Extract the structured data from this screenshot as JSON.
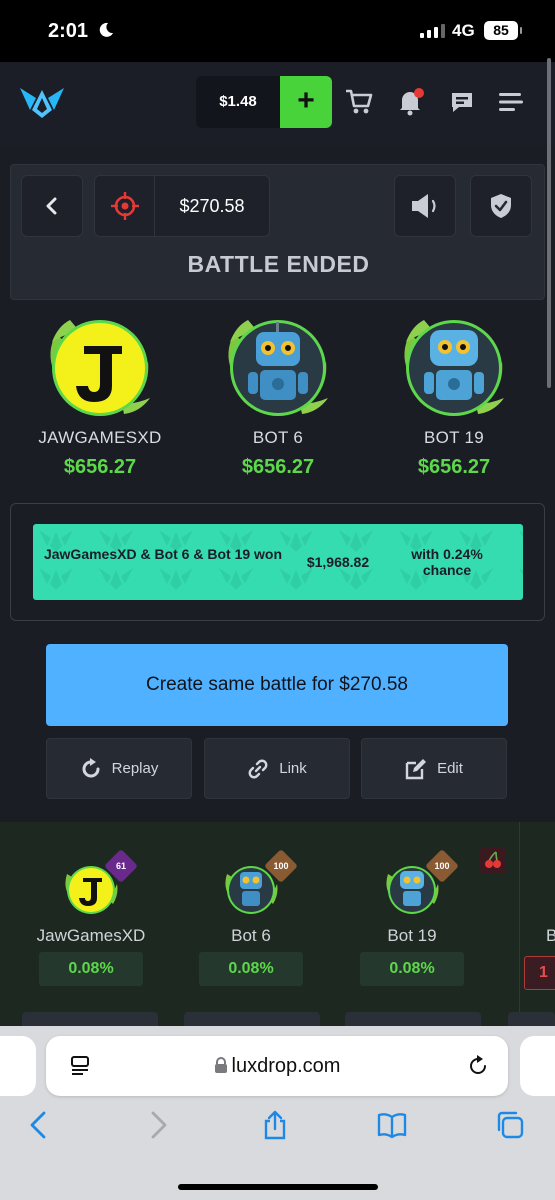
{
  "status_bar": {
    "time": "2:01",
    "network": "4G",
    "battery": "85"
  },
  "header": {
    "balance": "$1.48",
    "deposit_label": "+"
  },
  "battle": {
    "price": "$270.58",
    "title": "BATTLE ENDED"
  },
  "players": [
    {
      "name": "JAWGAMESXD",
      "amount": "$656.27"
    },
    {
      "name": "BOT 6",
      "amount": "$656.27"
    },
    {
      "name": "BOT 19",
      "amount": "$656.27"
    }
  ],
  "result": {
    "winners": "JawGamesXD & Bot 6 & Bot 19 won",
    "total": "$1,968.82",
    "chance": "with 0.24% chance"
  },
  "actions": {
    "create": "Create same battle for $270.58",
    "replay": "Replay",
    "link": "Link",
    "edit": "Edit"
  },
  "participants": [
    {
      "name": "JawGamesXD",
      "level": "61",
      "chance": "0.08%",
      "level_color": "#6a2a8c"
    },
    {
      "name": "Bot 6",
      "level": "100",
      "chance": "0.08%",
      "level_color": "#8a5a32"
    },
    {
      "name": "Bot 19",
      "level": "100",
      "chance": "0.08%",
      "level_color": "#8a5a32"
    }
  ],
  "peek": {
    "name": "B",
    "chance": "1"
  },
  "browser": {
    "url": "luxdrop.com"
  },
  "colors": {
    "accent_green": "#5dd84a",
    "result_teal": "#35dcb0",
    "button_blue": "#4fb1ff"
  }
}
